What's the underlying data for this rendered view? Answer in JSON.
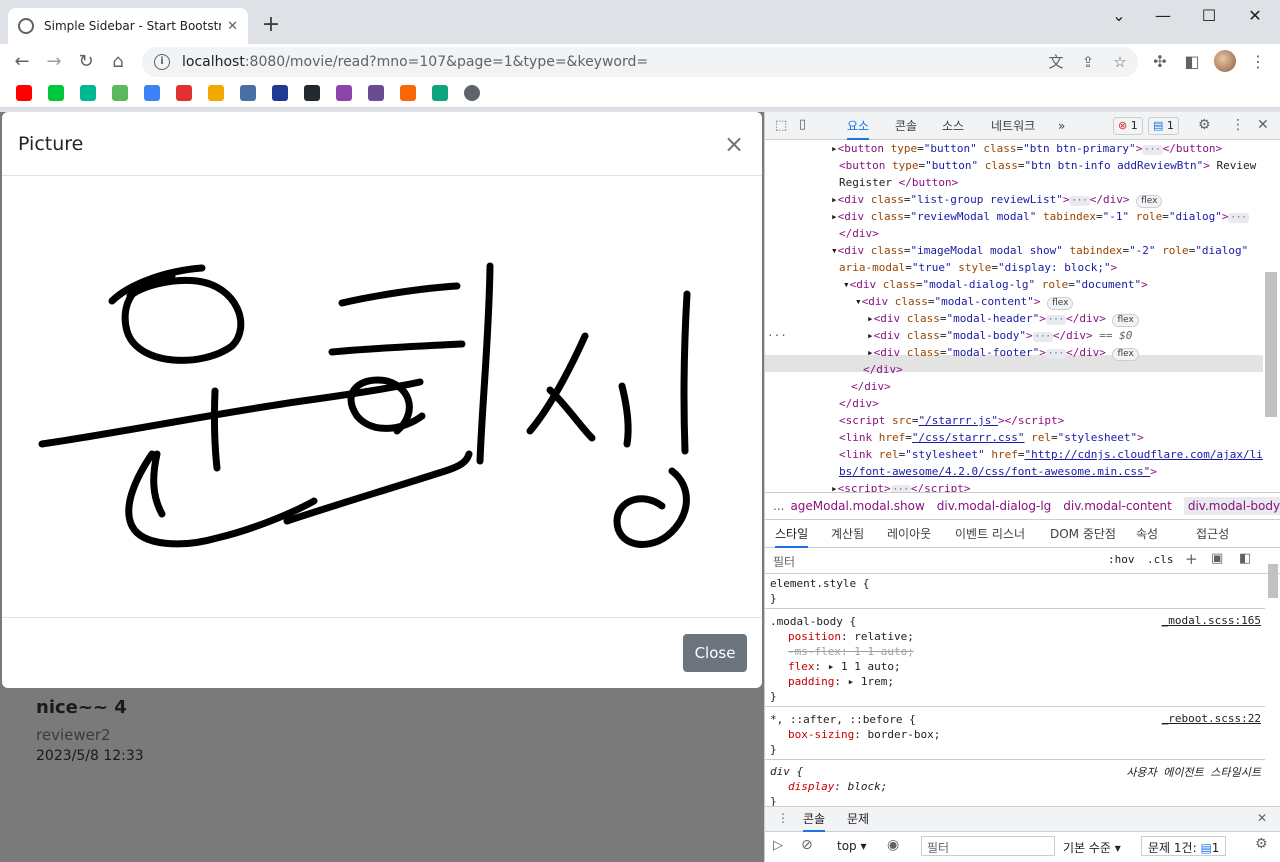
{
  "browser": {
    "tab_title": "Simple Sidebar - Start Bootstrap",
    "url_host": "localhost",
    "url_rest": ":8080/movie/read?mno=107&page=1&type=&keyword=",
    "bookmark_colors": [
      "#ff0000",
      "#00c73c",
      "#00b894",
      "#5cb85c",
      "#3b82f6",
      "#e03131",
      "#f2a900",
      "#4a6fa5",
      "#1f3a93",
      "#24292e",
      "#8e44ad",
      "#6a4c93",
      "#f76707",
      "#10a37f",
      "#5f6368"
    ]
  },
  "modal": {
    "title": "Picture",
    "close_x": "×",
    "close_button": "Close"
  },
  "review": {
    "text": "nice~~ 4",
    "user": "reviewer2",
    "date": "2023/5/8 12:33"
  },
  "devtools": {
    "tabs": [
      "요소",
      "콘솔",
      "소스",
      "네트워크"
    ],
    "more": "»",
    "errors": "1",
    "messages": "1",
    "breadcrumbs": [
      "...",
      "ageModal.modal.show",
      "div.modal-dialog-lg",
      "div.modal-content",
      "div.modal-body"
    ],
    "style_tabs": [
      "스타일",
      "계산됨",
      "레이아웃",
      "이벤트 리스너",
      "DOM 중단점",
      "속성",
      "접근성"
    ],
    "filter_placeholder": "필터",
    "hov": ":hov",
    "cls": ".cls",
    "element_style": "element.style {",
    "rule1_selector": ".modal-body {",
    "rule1_src": "_modal.scss:165",
    "rule1_p1": "position",
    "rule1_v1": "relative;",
    "rule1_p2": "-ms-flex: 1 1 auto;",
    "rule1_p3": "flex",
    "rule1_v3": "1 1 auto;",
    "rule1_p4": "padding",
    "rule1_v4": "1rem;",
    "rule2_selector": "*, ::after, ::before {",
    "rule2_src": "_reboot.scss:22",
    "rule2_p1": "box-sizing",
    "rule2_v1": "border-box;",
    "rule3_selector": "div {",
    "rule3_src": "사용자 에이전트 스타일시트",
    "rule3_p1": "display",
    "rule3_v1": "block;",
    "close_brace": "}",
    "drawer_tabs": [
      "콘솔",
      "문제"
    ],
    "console_context": "top",
    "console_filter": "필터",
    "console_level": "기본 수준",
    "console_issues": "문제 1건:",
    "console_issue_count": "1"
  }
}
